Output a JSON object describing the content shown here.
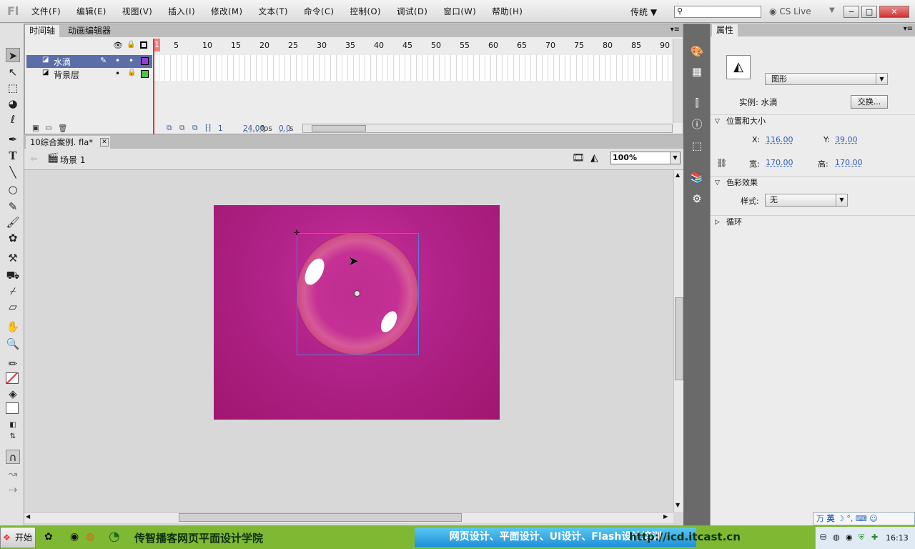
{
  "menubar": {
    "logo": "Fl",
    "menus": [
      "文件(F)",
      "编辑(E)",
      "视图(V)",
      "插入(I)",
      "修改(M)",
      "文本(T)",
      "命令(C)",
      "控制(O)",
      "调试(D)",
      "窗口(W)",
      "帮助(H)"
    ],
    "workspace": "传统",
    "cslive": "CS Live",
    "window_buttons": [
      "−",
      "□",
      "✕"
    ]
  },
  "timeline": {
    "tabs": [
      "时间轴",
      "动画编辑器"
    ],
    "ruler": [
      "1",
      "5",
      "10",
      "15",
      "20",
      "25",
      "30",
      "35",
      "40",
      "45",
      "50",
      "55",
      "60",
      "65",
      "70",
      "75",
      "80",
      "85",
      "90"
    ],
    "layers": [
      {
        "name": "水滴",
        "selected": true,
        "color": "#9b3ad6"
      },
      {
        "name": "背景层",
        "selected": false,
        "color": "#46c846"
      }
    ],
    "footer": {
      "frame": "1",
      "fps": "24.00",
      "fps_unit": "fps",
      "time": "0.0",
      "time_unit": "s"
    }
  },
  "document": {
    "tab": "10综合案例. fla*",
    "scene": "场景 1",
    "zoom": "100%"
  },
  "properties": {
    "title": "属性",
    "type": "图形",
    "instance_label": "实例: 水滴",
    "swap_button": "交换...",
    "position_section": "位置和大小",
    "x_label": "X:",
    "x_value": "116.00",
    "y_label": "Y:",
    "y_value": "39.00",
    "w_label": "宽:",
    "w_value": "170.00",
    "h_label": "高:",
    "h_value": "170.00",
    "color_section": "色彩效果",
    "style_label": "样式:",
    "style_value": "无",
    "loop_section": "循环"
  },
  "taskbar": {
    "start": "开始",
    "school": "传智播客网页平面设计学院",
    "courses": "网页设计、平面设计、UI设计、Flash设计培训",
    "url": "http://icd.itcast.cn",
    "ime": "英",
    "clock": "16:13"
  },
  "colors": {
    "stage": "#b02288",
    "accent_link": "#2a5ab8",
    "playhead": "#e53030",
    "taskbar": "#7fb832"
  }
}
